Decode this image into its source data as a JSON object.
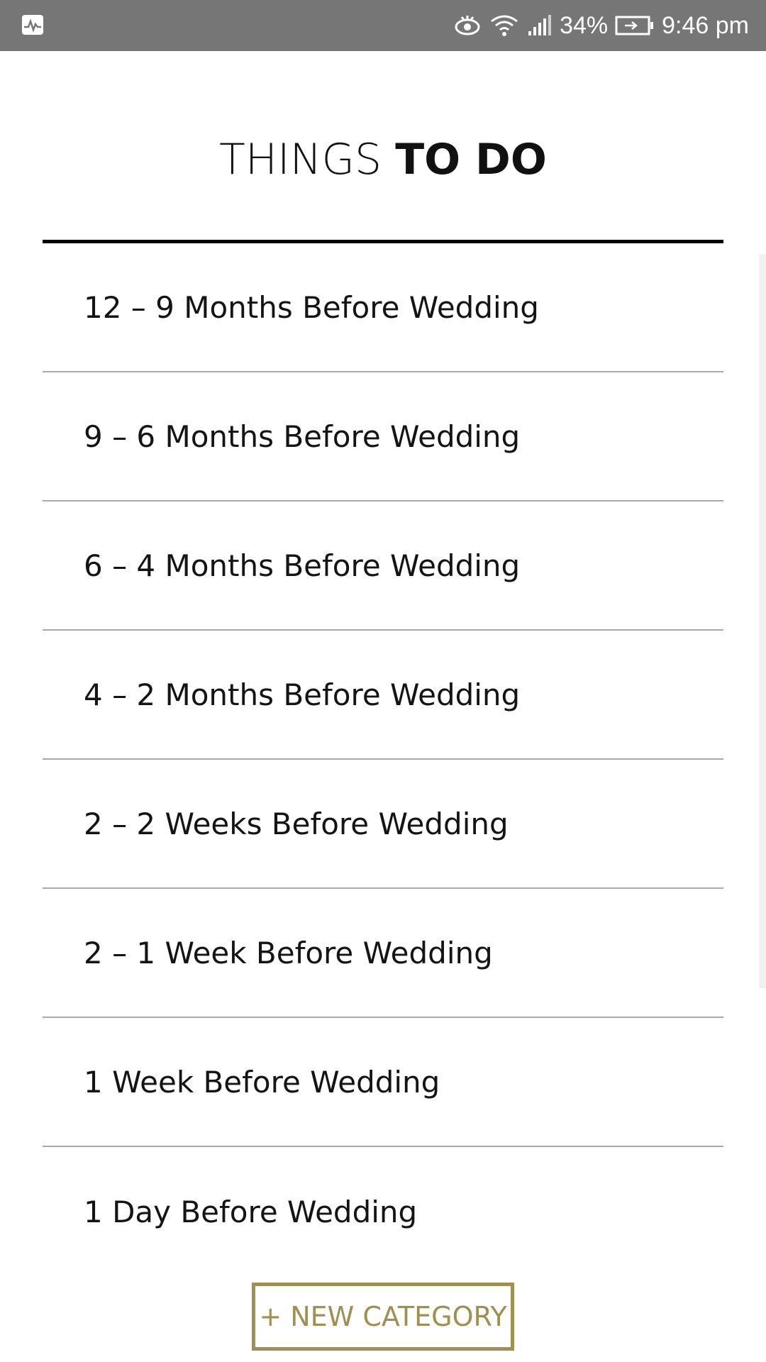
{
  "status_bar": {
    "left_icon": "activity-pulse-icon",
    "icons": [
      "eye-icon",
      "wifi-icon",
      "signal-icon"
    ],
    "battery_percent": "34%",
    "battery_icon": "battery-charging-icon",
    "time": "9:46 pm"
  },
  "header": {
    "title_light": "THINGS",
    "title_bold": "TO DO"
  },
  "categories": [
    "12 – 9 Months Before Wedding",
    "9 – 6 Months Before Wedding",
    "6 – 4 Months Before Wedding",
    "4 – 2 Months Before Wedding",
    "2 – 2 Weeks Before Wedding",
    "2 – 1 Week Before Wedding",
    "1 Week Before Wedding",
    "1 Day Before Wedding"
  ],
  "actions": {
    "new_category_label": "+ NEW CATEGORY"
  },
  "colors": {
    "status_bar": "#767676",
    "accent_gold": "#a08f4e",
    "divider": "#a9a9a9"
  }
}
